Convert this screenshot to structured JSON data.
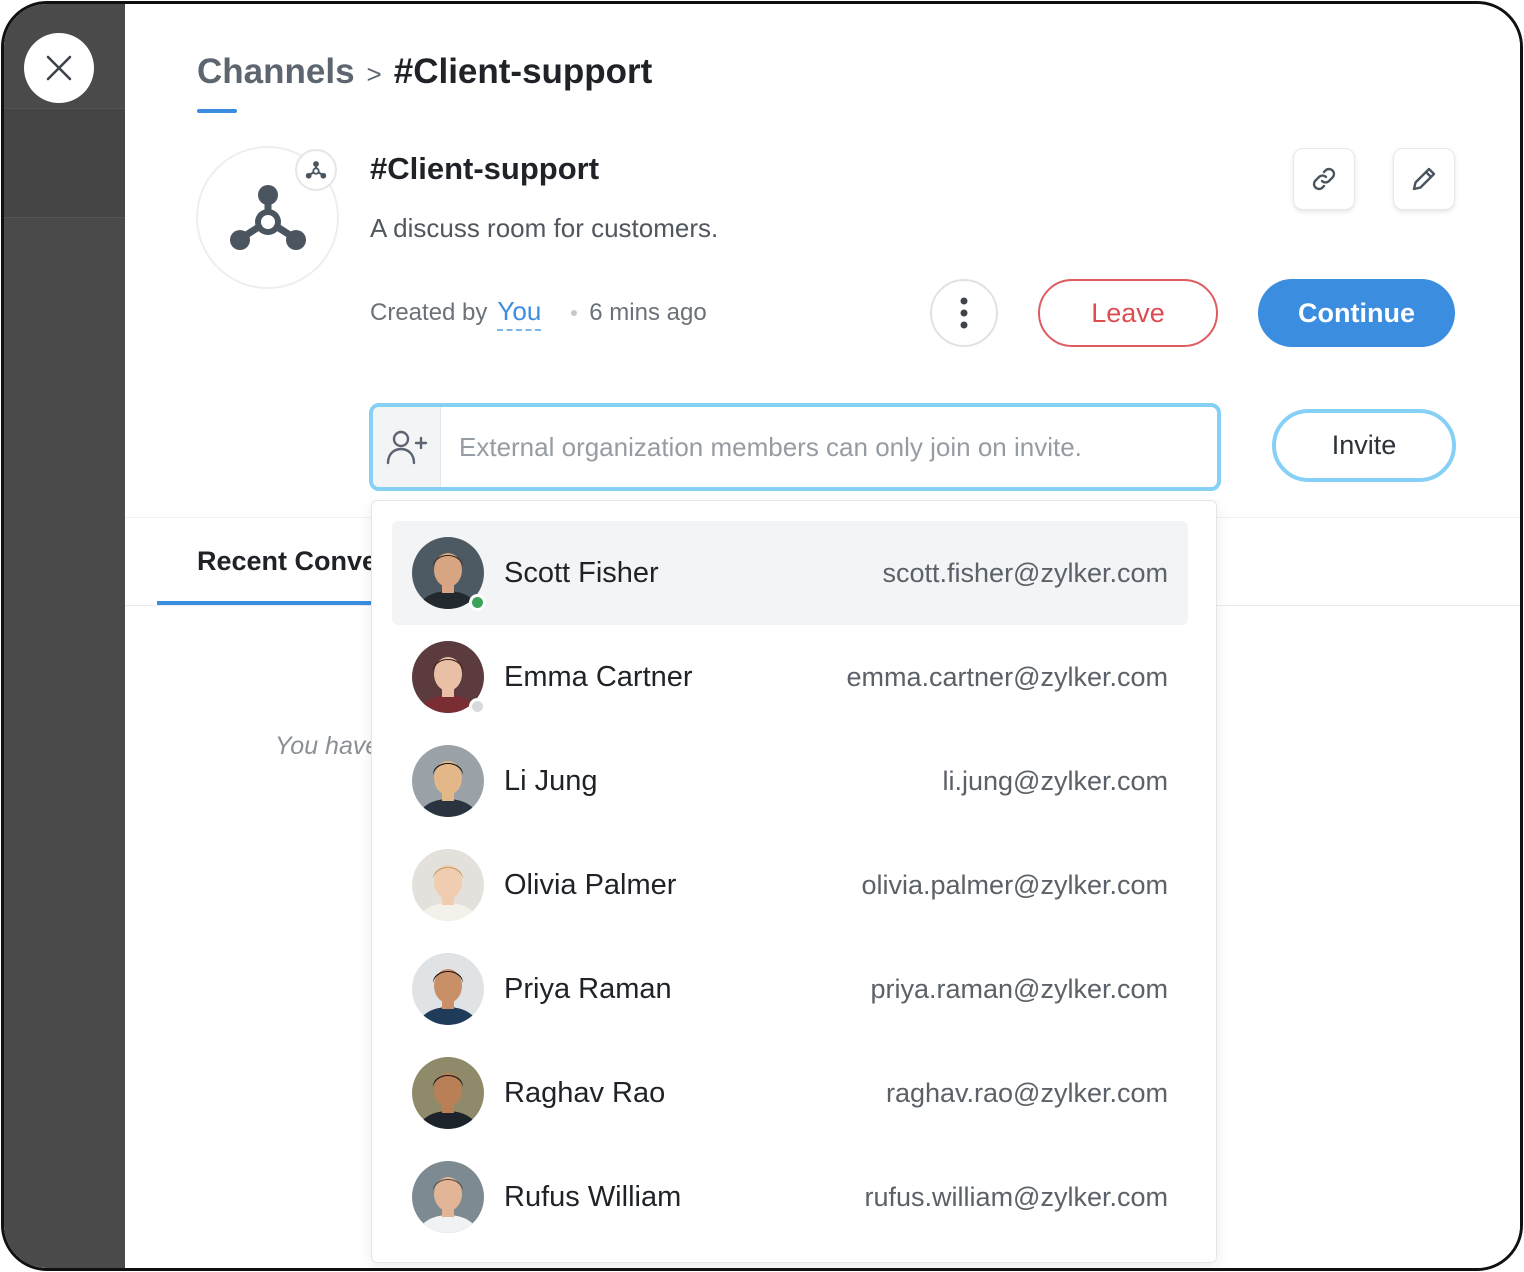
{
  "breadcrumb": {
    "root": "Channels",
    "separator": ">",
    "current": "#Client-support"
  },
  "channel": {
    "title": "#Client-support",
    "description": "A discuss room for customers.",
    "created_by_label": "Created by",
    "created_by_user": "You",
    "created_time": "6 mins ago"
  },
  "actions": {
    "leave_label": "Leave",
    "continue_label": "Continue",
    "invite_label": "Invite"
  },
  "invite": {
    "placeholder": "External organization members can only join on invite."
  },
  "tabs": {
    "recent": "Recent Conve"
  },
  "empty_state": {
    "text": "You have"
  },
  "colors": {
    "accent": "#3b8de0",
    "leave": "#de4b51",
    "focus": "#86d0f5",
    "online": "#3aa35c",
    "offline": "#d7d9dc"
  },
  "members": [
    {
      "name": "Scott Fisher",
      "email": "scott.fisher@zylker.com",
      "status": "online",
      "highlighted": true,
      "skin": "#d8a583",
      "hair": "#3b2a20",
      "bg": "#4d5a63",
      "shirt": "#222a30"
    },
    {
      "name": "Emma Cartner",
      "email": "emma.cartner@zylker.com",
      "status": "offline",
      "highlighted": false,
      "skin": "#e9c0a5",
      "hair": "#3a1f1a",
      "bg": "#5b3b3e",
      "shirt": "#7a2d33"
    },
    {
      "name": "Li Jung",
      "email": "li.jung@zylker.com",
      "status": "none",
      "highlighted": false,
      "skin": "#e3b788",
      "hair": "#111111",
      "bg": "#9aa2a7",
      "shirt": "#2a3440"
    },
    {
      "name": "Olivia Palmer",
      "email": "olivia.palmer@zylker.com",
      "status": "none",
      "highlighted": false,
      "skin": "#f0cdb0",
      "hair": "#c79c63",
      "bg": "#e4e1dc",
      "shirt": "#f4f1ea"
    },
    {
      "name": "Priya Raman",
      "email": "priya.raman@zylker.com",
      "status": "none",
      "highlighted": false,
      "skin": "#c98f66",
      "hair": "#1e1410",
      "bg": "#dfe3e6",
      "shirt": "#203a5a"
    },
    {
      "name": "Raghav Rao",
      "email": "raghav.rao@zylker.com",
      "status": "none",
      "highlighted": false,
      "skin": "#b98058",
      "hair": "#1b1410",
      "bg": "#8f8a6a",
      "shirt": "#1d232b"
    },
    {
      "name": "Rufus William",
      "email": "rufus.william@zylker.com",
      "status": "none",
      "highlighted": false,
      "skin": "#e1b596",
      "hair": "#5a4a3c",
      "bg": "#7d8a92",
      "shirt": "#f1f2f3"
    }
  ]
}
